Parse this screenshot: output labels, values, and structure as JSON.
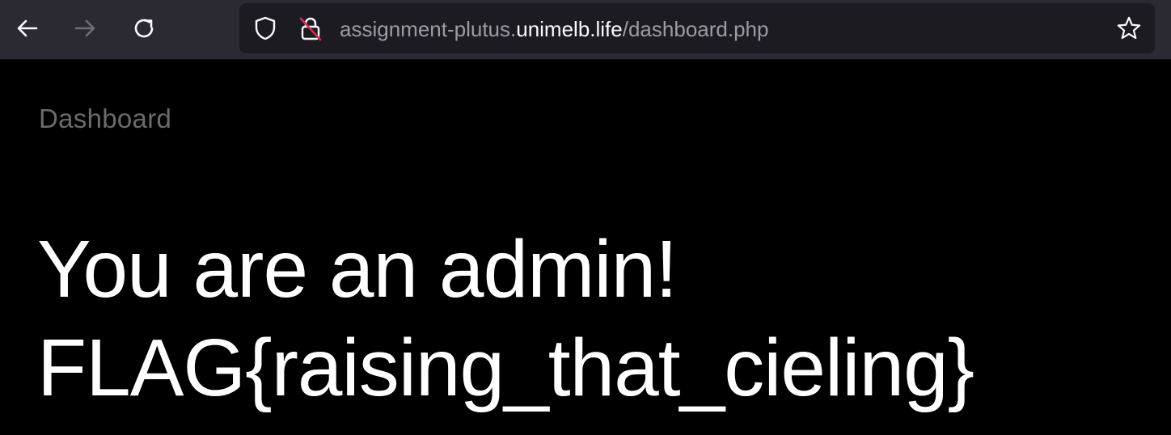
{
  "browser": {
    "back_icon": "back-arrow-icon",
    "forward_icon": "forward-arrow-icon",
    "reload_icon": "reload-icon",
    "tracking_icon": "shield-icon",
    "insecure_icon": "insecure-lock-icon",
    "bookmark_icon": "star-icon",
    "url": {
      "prefix": "assignment-plutus.",
      "host": "unimelb.life",
      "path": "/dashboard.php"
    }
  },
  "page": {
    "heading": "Dashboard",
    "message_line1": "You are an admin!",
    "message_line2": "FLAG{raising_that_cieling}"
  },
  "colors": {
    "toolbar": "#2b2a33",
    "urlbar": "#1c1b22",
    "page_bg": "#000000",
    "insecure_slash": "#e22850"
  }
}
